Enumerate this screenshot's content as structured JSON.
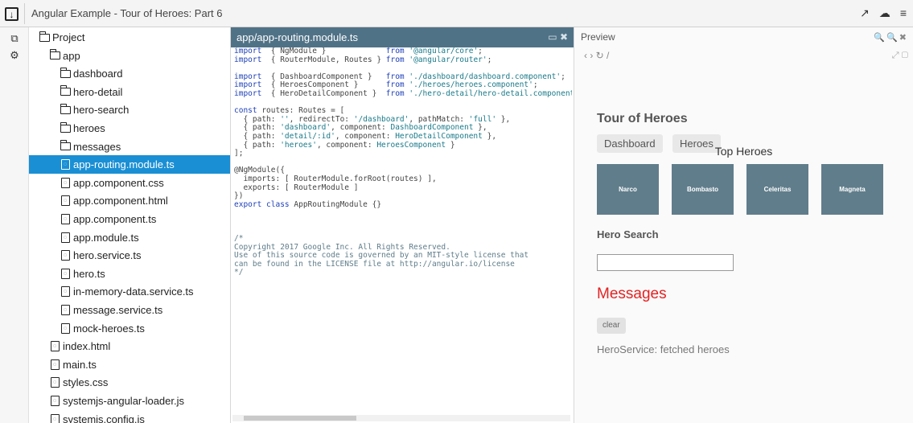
{
  "window": {
    "title": "Angular Example - Tour of Heroes: Part 6",
    "menu_icon": "download-arrow-icon",
    "right_icons": [
      "external-link-icon",
      "cloud-icon",
      "hamburger-menu-icon"
    ]
  },
  "left_toolbar": {
    "icons": [
      "copy-icon",
      "settings-gear-icon"
    ]
  },
  "file_tree": {
    "items": [
      {
        "label": "Project",
        "type": "folder-open",
        "indent": 0
      },
      {
        "label": "app",
        "type": "folder-open",
        "indent": 1
      },
      {
        "label": "dashboard",
        "type": "folder",
        "indent": 2
      },
      {
        "label": "hero-detail",
        "type": "folder",
        "indent": 2
      },
      {
        "label": "hero-search",
        "type": "folder",
        "indent": 2
      },
      {
        "label": "heroes",
        "type": "folder",
        "indent": 2
      },
      {
        "label": "messages",
        "type": "folder",
        "indent": 2
      },
      {
        "label": "app-routing.module.ts",
        "type": "file",
        "indent": 2,
        "selected": true
      },
      {
        "label": "app.component.css",
        "type": "file",
        "indent": 2
      },
      {
        "label": "app.component.html",
        "type": "file",
        "indent": 2
      },
      {
        "label": "app.component.ts",
        "type": "file",
        "indent": 2
      },
      {
        "label": "app.module.ts",
        "type": "file",
        "indent": 2
      },
      {
        "label": "hero.service.ts",
        "type": "file",
        "indent": 2
      },
      {
        "label": "hero.ts",
        "type": "file",
        "indent": 2
      },
      {
        "label": "in-memory-data.service.ts",
        "type": "file",
        "indent": 2
      },
      {
        "label": "message.service.ts",
        "type": "file",
        "indent": 2
      },
      {
        "label": "mock-heroes.ts",
        "type": "file",
        "indent": 2
      },
      {
        "label": "index.html",
        "type": "file",
        "indent": 1
      },
      {
        "label": "main.ts",
        "type": "file",
        "indent": 1
      },
      {
        "label": "styles.css",
        "type": "file",
        "indent": 1
      },
      {
        "label": "systemjs-angular-loader.js",
        "type": "file",
        "indent": 1
      },
      {
        "label": "systemjs.config.js",
        "type": "file",
        "indent": 1
      }
    ]
  },
  "editor": {
    "tab_title": "app/app-routing.module.ts",
    "tab_actions": "▭ ✖",
    "code_lines": [
      [
        [
          "kw",
          "import"
        ],
        [
          "",
          "  { NgModule }             "
        ],
        [
          "kw",
          "from"
        ],
        [
          "",
          ""
        ],
        [
          "str",
          " '@angular/core'"
        ],
        [
          "",
          ";"
        ]
      ],
      [
        [
          "kw",
          "import"
        ],
        [
          "",
          "  { RouterModule, Routes } "
        ],
        [
          "kw",
          "from"
        ],
        [
          "str",
          " '@angular/router'"
        ],
        [
          "",
          ";"
        ]
      ],
      [
        [
          "",
          ""
        ]
      ],
      [
        [
          "kw",
          "import"
        ],
        [
          "",
          "  { DashboardComponent }   "
        ],
        [
          "kw",
          "from"
        ],
        [
          "str",
          " './dashboard/dashboard.component'"
        ],
        [
          "",
          ";"
        ]
      ],
      [
        [
          "kw",
          "import"
        ],
        [
          "",
          "  { HeroesComponent }      "
        ],
        [
          "kw",
          "from"
        ],
        [
          "str",
          " './heroes/heroes.component'"
        ],
        [
          "",
          ";"
        ]
      ],
      [
        [
          "kw",
          "import"
        ],
        [
          "",
          "  { HeroDetailComponent }  "
        ],
        [
          "kw",
          "from"
        ],
        [
          "str",
          " './hero-detail/hero-detail.component'"
        ],
        [
          "",
          ";"
        ]
      ],
      [
        [
          "",
          ""
        ]
      ],
      [
        [
          "kw",
          "const"
        ],
        [
          "",
          " routes: Routes = ["
        ]
      ],
      [
        [
          "",
          "  { path: "
        ],
        [
          "str",
          "''"
        ],
        [
          "",
          ", redirectTo: "
        ],
        [
          "str",
          "'/dashboard'"
        ],
        [
          "",
          ", pathMatch: "
        ],
        [
          "str",
          "'full'"
        ],
        [
          "",
          " },"
        ]
      ],
      [
        [
          "",
          "  { path: "
        ],
        [
          "str",
          "'dashboard'"
        ],
        [
          "",
          ", component: "
        ],
        [
          "str",
          "DashboardComponent"
        ],
        [
          "",
          " },"
        ]
      ],
      [
        [
          "",
          "  { path: "
        ],
        [
          "str",
          "'detail/:id'"
        ],
        [
          "",
          ", component: "
        ],
        [
          "str",
          "HeroDetailComponent"
        ],
        [
          "",
          " },"
        ]
      ],
      [
        [
          "",
          "  { path: "
        ],
        [
          "str",
          "'heroes'"
        ],
        [
          "",
          ", component: "
        ],
        [
          "str",
          "HeroesComponent"
        ],
        [
          "",
          " }"
        ]
      ],
      [
        [
          "",
          "];"
        ]
      ],
      [
        [
          "",
          ""
        ]
      ],
      [
        [
          "",
          "@NgModule({"
        ]
      ],
      [
        [
          "",
          "  imports: [ RouterModule.forRoot(routes) ],"
        ]
      ],
      [
        [
          "",
          "  exports: [ RouterModule ]"
        ]
      ],
      [
        [
          "",
          "})"
        ]
      ],
      [
        [
          "kw",
          "export"
        ],
        [
          "",
          ""
        ],
        [
          "kw",
          " class"
        ],
        [
          "",
          " AppRoutingModule {}"
        ]
      ],
      [
        [
          "",
          ""
        ]
      ],
      [
        [
          "",
          ""
        ]
      ],
      [
        [
          "",
          ""
        ]
      ],
      [
        [
          "cm",
          "/*"
        ]
      ],
      [
        [
          "cm",
          "Copyright 2017 Google Inc. All Rights Reserved."
        ]
      ],
      [
        [
          "cm",
          "Use of this source code is governed by an MIT-style license that"
        ]
      ],
      [
        [
          "cm",
          "can be found in the LICENSE file at http://angular.io/license"
        ]
      ],
      [
        [
          "cm",
          "*/"
        ]
      ]
    ]
  },
  "preview": {
    "label": "Preview",
    "head_actions": "🔍🔍✖",
    "nav_text": "‹  ›  ↻  /",
    "nav_right": "⤢ ▢",
    "app_title": "Tour of Heroes",
    "nav_buttons": [
      "Dashboard",
      "Heroes"
    ],
    "top_heroes_title": "Top Heroes",
    "heroes": [
      "Narco",
      "Bombasto",
      "Celeritas",
      "Magneta"
    ],
    "search_title": "Hero Search",
    "messages_title": "Messages",
    "clear_label": "clear",
    "message_lines": [
      "HeroService: fetched heroes"
    ]
  },
  "colors": {
    "selected_tree": "#1a8fd4",
    "editor_tab": "#507286",
    "hero_card": "#607d8b",
    "messages_red": "#e52222"
  }
}
